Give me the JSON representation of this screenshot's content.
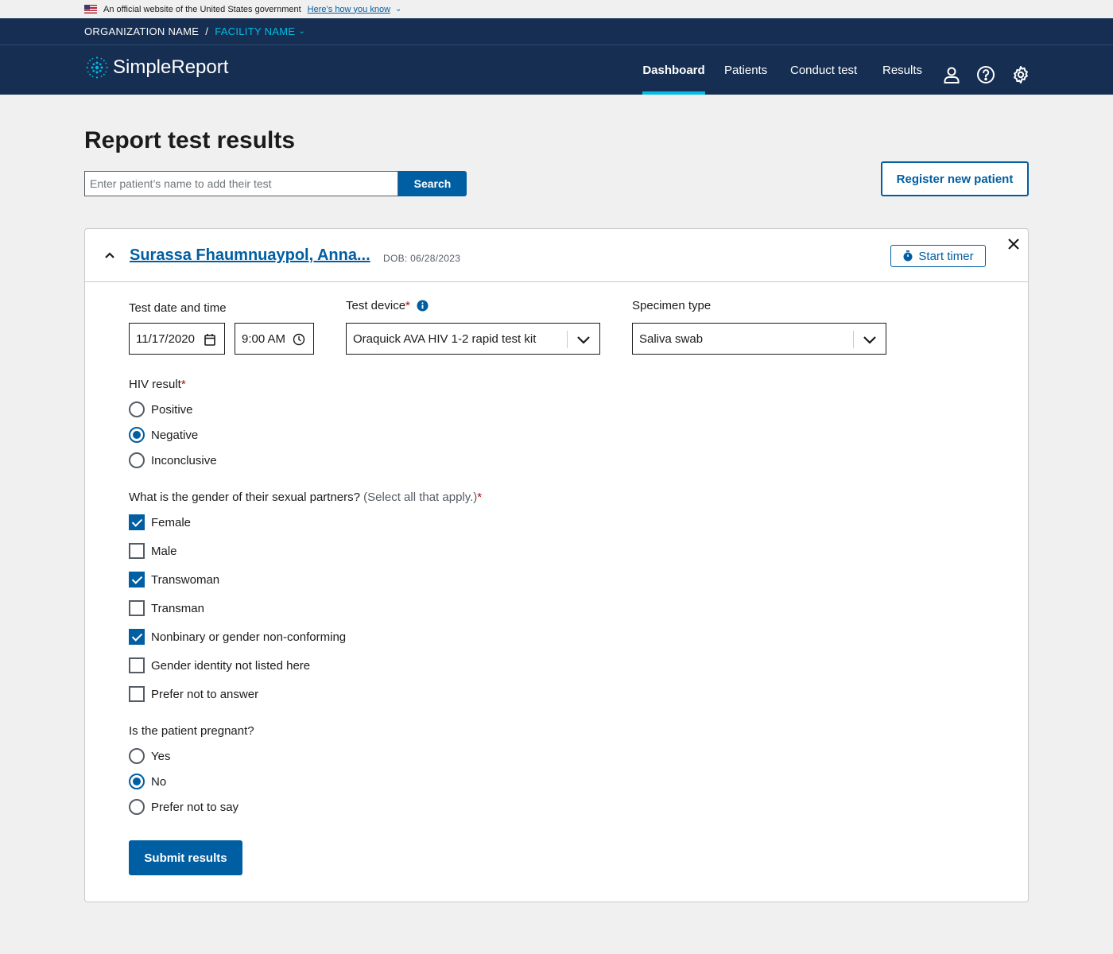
{
  "gov_banner": {
    "text": "An official website of the United States government",
    "link": "Here’s how you know"
  },
  "org_bar": {
    "organization": "ORGANIZATION NAME",
    "separator": "/",
    "facility": "FACILITY NAME"
  },
  "header": {
    "app_name": "SimpleReport",
    "nav": [
      {
        "label": "Dashboard",
        "active": true
      },
      {
        "label": "Patients",
        "active": false
      },
      {
        "label": "Conduct test",
        "active": false
      },
      {
        "label": "Results",
        "active": false
      }
    ],
    "icons": [
      "user-icon",
      "help-icon",
      "gear-icon"
    ]
  },
  "main": {
    "title": "Report test results",
    "search": {
      "placeholder": "Enter patient’s name to add their test",
      "button": "Search"
    },
    "register_button": "Register new patient"
  },
  "card": {
    "patient_name": "Surassa Fhaumnuaypol, Anna...",
    "dob": "DOB: 06/28/2023",
    "timer_button": "Start timer",
    "test_date_label": "Test date and time",
    "test_date": "11/17/2020",
    "test_time": "9:00 AM",
    "device_label": "Test device",
    "device_value": "Oraquick AVA HIV 1-2 rapid test kit",
    "specimen_label": "Specimen type",
    "specimen_value": "Saliva swab",
    "required_mark": "*",
    "hiv_label": "HIV result",
    "hiv_options": [
      {
        "label": "Positive",
        "checked": false
      },
      {
        "label": "Negative",
        "checked": true
      },
      {
        "label": "Inconclusive",
        "checked": false
      }
    ],
    "partners_label": "What is the gender of their sexual partners?",
    "partners_hint": "(Select all that apply.)",
    "partner_options": [
      {
        "label": "Female",
        "checked": true
      },
      {
        "label": "Male",
        "checked": false
      },
      {
        "label": "Transwoman",
        "checked": true
      },
      {
        "label": "Transman",
        "checked": false
      },
      {
        "label": "Nonbinary or gender non-conforming",
        "checked": true
      },
      {
        "label": "Gender identity not listed here",
        "checked": false
      },
      {
        "label": "Prefer not to answer",
        "checked": false
      }
    ],
    "pregnant_label": "Is the patient pregnant?",
    "pregnant_options": [
      {
        "label": "Yes",
        "checked": false
      },
      {
        "label": "No",
        "checked": true
      },
      {
        "label": "Prefer not to say",
        "checked": false
      }
    ],
    "submit_button": "Submit results"
  },
  "colors": {
    "primary": "#005ea2",
    "header_bg": "#162e51",
    "accent": "#00bde3",
    "required": "#b50909"
  }
}
